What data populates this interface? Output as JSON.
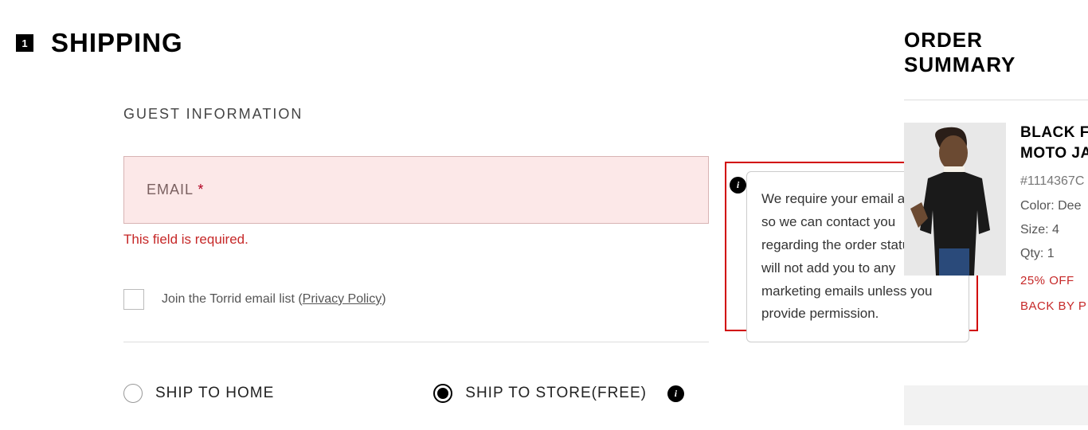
{
  "step": {
    "number": "1",
    "title": "SHIPPING"
  },
  "guest": {
    "section_label": "GUEST INFORMATION",
    "email_label": "EMAIL ",
    "email_required_marker": "*",
    "email_value": "",
    "error": "This field is required.",
    "join_label": "Join the Torrid email list (",
    "privacy_label": "Privacy Policy",
    "join_label_close": ")"
  },
  "tooltip": {
    "text": "We require your email address so we can contact you regarding the order status. We will not add you to any marketing emails unless you provide permission.",
    "info_glyph": "i"
  },
  "ship": {
    "home_label": "SHIP TO HOME",
    "store_label": "SHIP TO STORE(FREE)",
    "info_glyph": "i"
  },
  "summary": {
    "title": "ORDER SUMMARY",
    "product": {
      "name_line1": "BLACK FAU",
      "name_line2": "MOTO JACK",
      "sku": "#1114367C",
      "color_label": "Color: Dee",
      "size_label": "Size: 4",
      "qty_label": "Qty: 1",
      "promo1": "25% OFF",
      "promo2": "BACK BY P"
    }
  }
}
